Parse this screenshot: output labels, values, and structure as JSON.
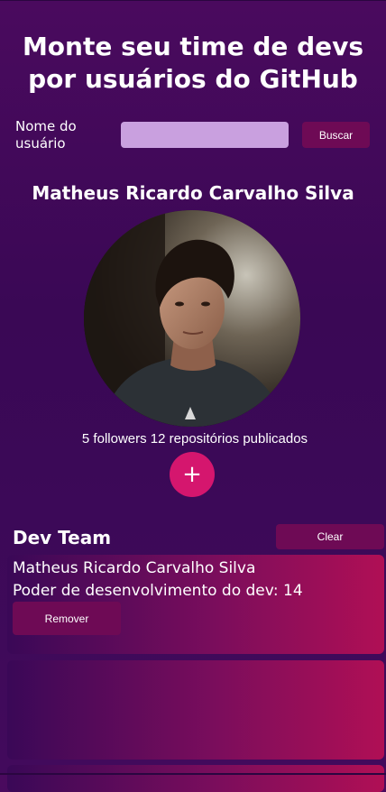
{
  "header": {
    "title": "Monte seu time de devs por usuários do GitHub"
  },
  "search": {
    "label": "Nome do usuário",
    "value": "",
    "placeholder": "",
    "button_label": "Buscar"
  },
  "profile": {
    "name": "Matheus Ricardo Carvalho Silva",
    "stats": "5 followers 12 repositórios publicados",
    "add_label": "+"
  },
  "team": {
    "title": "Dev Team",
    "clear_label": "Clear",
    "members": [
      {
        "name": "Matheus Ricardo Carvalho Silva",
        "power_text": "Poder de desenvolvimento do dev: 14",
        "remove_label": "Remover"
      }
    ]
  },
  "colors": {
    "background": "#3b0957",
    "button": "#6e0a55",
    "add_button": "#d5166e",
    "input": "#c9a0df",
    "card_end": "#b00f55"
  }
}
